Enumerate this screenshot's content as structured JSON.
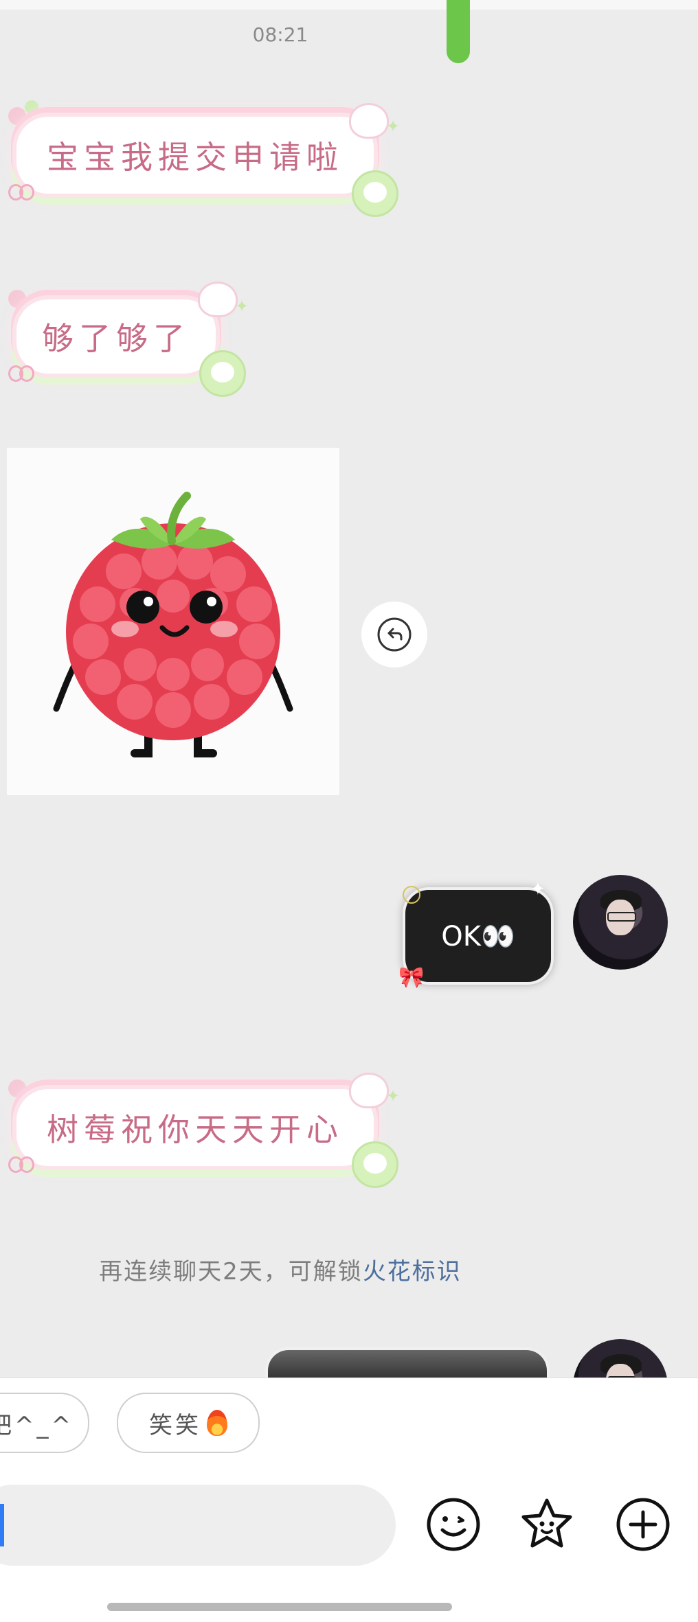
{
  "status": {
    "time": "08:21"
  },
  "messages": {
    "m1_text": "宝宝我提交申请啦",
    "m2_text": "够了够了",
    "m4_text": "OK👀",
    "m5_text": "树莓祝你天天开心"
  },
  "system_notice": {
    "prefix": "再连续聊天2天，可解锁",
    "link": "火花标识"
  },
  "suggestions": [
    {
      "label": "吧^_^"
    },
    {
      "label": "笑笑"
    }
  ],
  "input": {
    "value": ""
  },
  "colors": {
    "accent": "#2f7cf6",
    "link": "#4e6f9e",
    "bubble_text": "#c76b86",
    "green_indicator": "#6cc64a"
  },
  "icons": [
    "reply-icon",
    "emoji-icon",
    "sticker-star-icon",
    "add-icon",
    "flame-icon"
  ]
}
